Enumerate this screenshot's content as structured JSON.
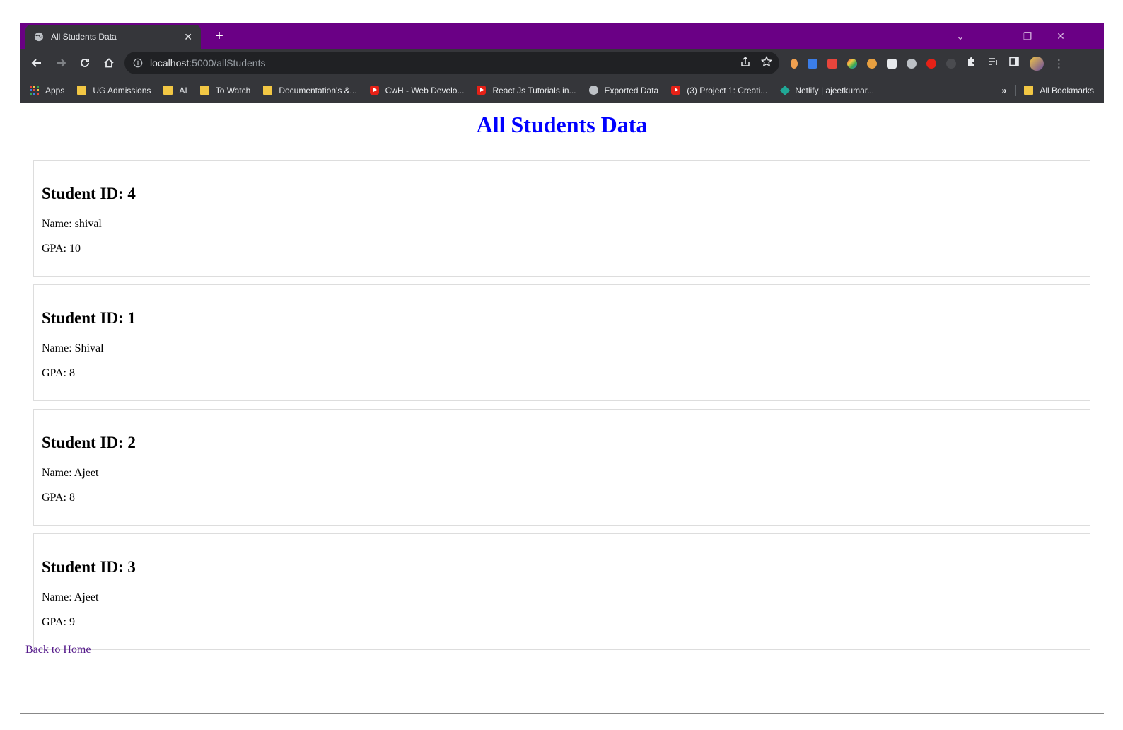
{
  "browser": {
    "tab_title": "All Students Data",
    "url_host": "localhost",
    "url_path": ":5000/allStudents",
    "theme_color": "#6a0085",
    "bookmarks": [
      {
        "label": "Apps",
        "icon": "apps-grid-icon"
      },
      {
        "label": "UG Admissions",
        "icon": "folder-icon"
      },
      {
        "label": "AI",
        "icon": "folder-icon"
      },
      {
        "label": "To Watch",
        "icon": "folder-icon"
      },
      {
        "label": "Documentation's &...",
        "icon": "folder-icon"
      },
      {
        "label": "CwH - Web Develo...",
        "icon": "youtube-icon"
      },
      {
        "label": "React Js Tutorials in...",
        "icon": "youtube-icon"
      },
      {
        "label": "Exported Data",
        "icon": "globe-icon"
      },
      {
        "label": "(3) Project 1: Creati...",
        "icon": "youtube-icon"
      },
      {
        "label": "Netlify | ajeetkumar...",
        "icon": "netlify-icon"
      }
    ],
    "overflow_label": "»",
    "all_bookmarks_label": "All Bookmarks"
  },
  "page": {
    "title": "All Students Data",
    "title_color": "#0000ff",
    "students": [
      {
        "id_label": "Student ID: 4",
        "name_label": "Name: shival",
        "gpa_label": "GPA: 10"
      },
      {
        "id_label": "Student ID: 1",
        "name_label": "Name: Shival",
        "gpa_label": "GPA: 8"
      },
      {
        "id_label": "Student ID: 2",
        "name_label": "Name: Ajeet",
        "gpa_label": "GPA: 8"
      },
      {
        "id_label": "Student ID: 3",
        "name_label": "Name: Ajeet",
        "gpa_label": "GPA: 9"
      }
    ],
    "back_link": "Back to Home"
  }
}
